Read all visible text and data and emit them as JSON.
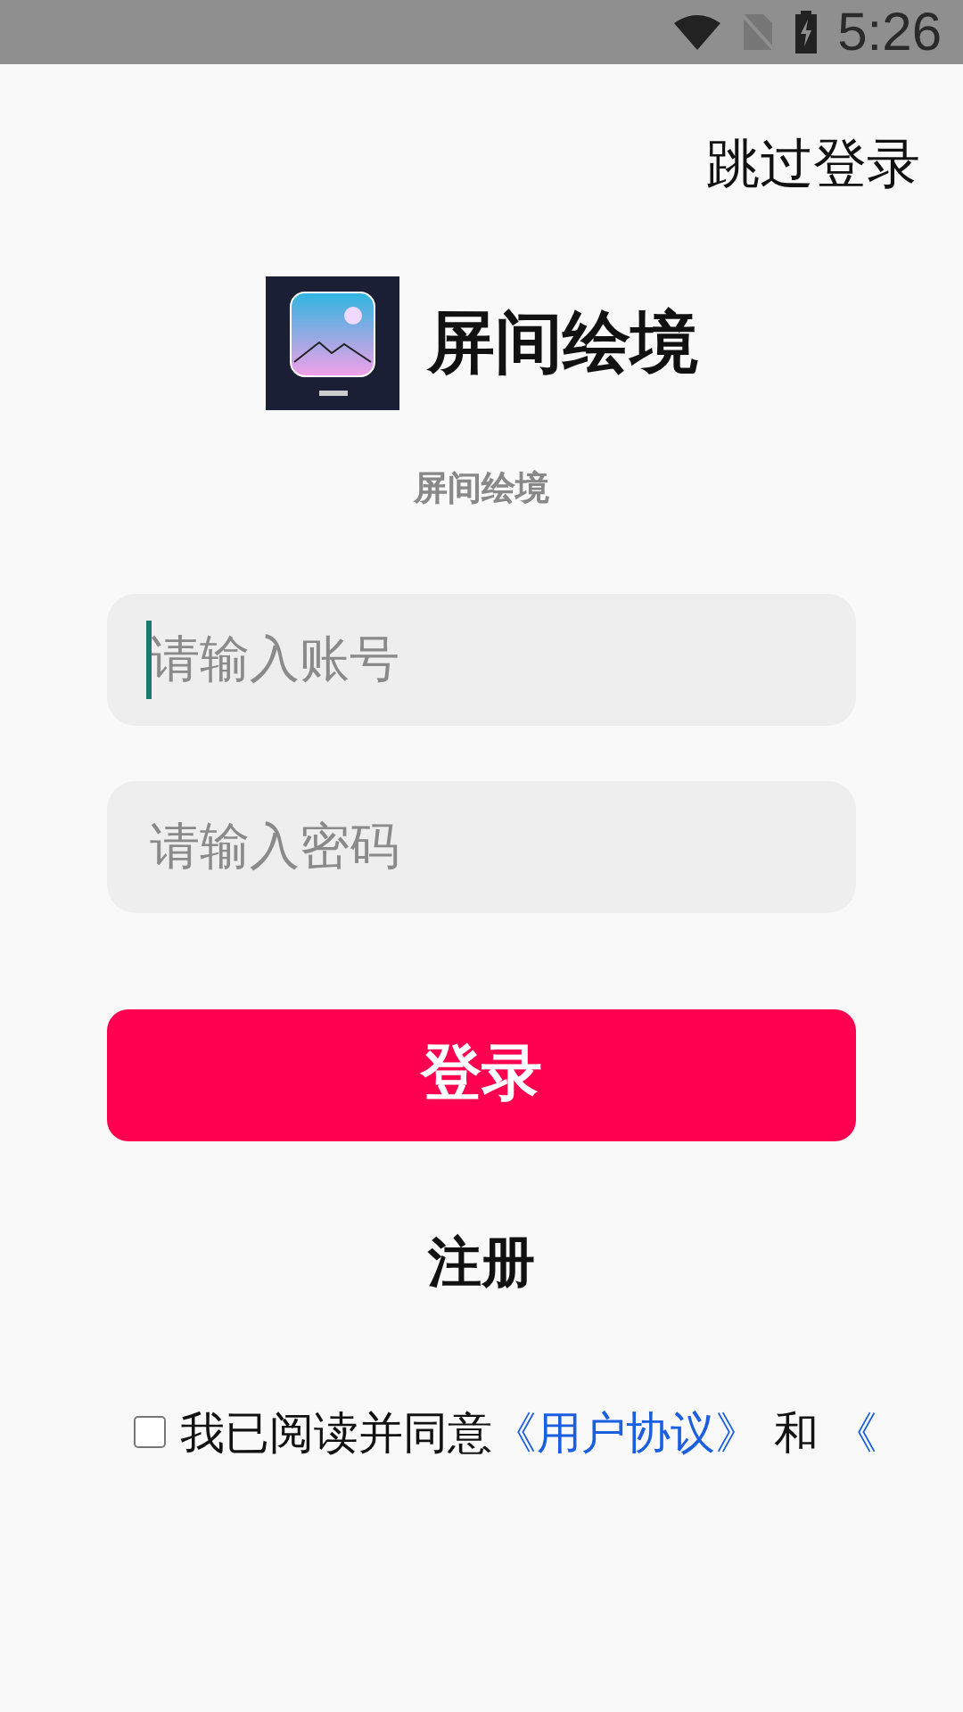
{
  "status_bar": {
    "time": "5:26"
  },
  "skip_link": "跳过登录",
  "app": {
    "name": "屏间绘境",
    "subtitle": "屏间绘境"
  },
  "fields": [
    {
      "placeholder": "请输入账号",
      "focused": true
    },
    {
      "placeholder": "请输入密码",
      "focused": false
    }
  ],
  "login_button": "登录",
  "register_link": "注册",
  "agreement": {
    "checked": false,
    "text": "我已阅读并同意",
    "link_1": "《用户协议》",
    "joiner": "和",
    "link_2": "《"
  }
}
